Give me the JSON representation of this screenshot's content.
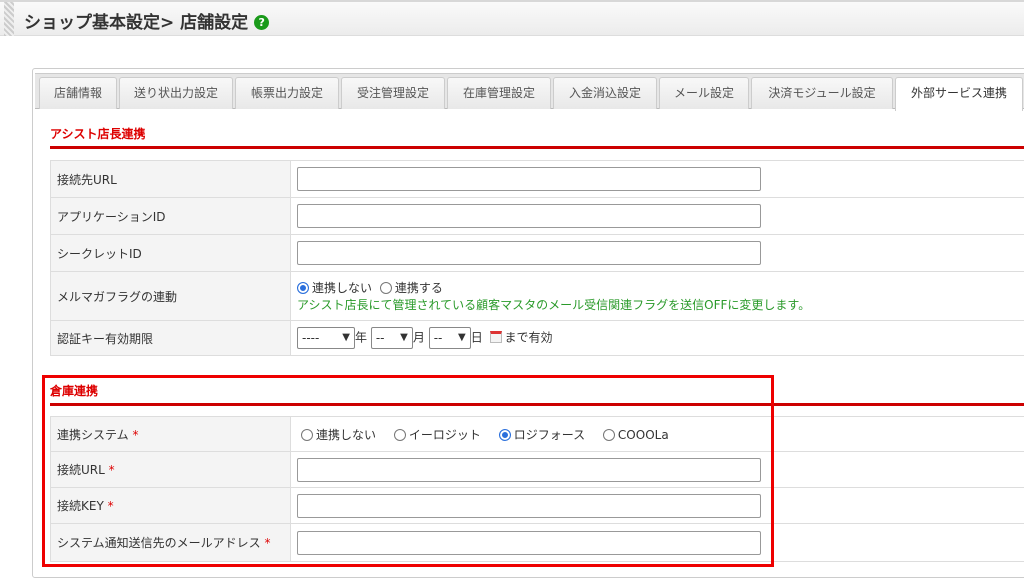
{
  "header": {
    "title": "ショップ基本設定> 店舗設定",
    "help_icon": "?"
  },
  "tabs": [
    "店舗情報",
    "送り状出力設定",
    "帳票出力設定",
    "受注管理設定",
    "在庫管理設定",
    "入金消込設定",
    "メール設定",
    "決済モジュール設定",
    "外部サービス連携"
  ],
  "active_tab": "外部サービス連携",
  "assist": {
    "title": "アシスト店長連携",
    "url_label": "接続先URL",
    "url_value": "",
    "app_id_label": "アプリケーションID",
    "app_id_value": "",
    "secret_label": "シークレットID",
    "secret_value": "",
    "mailmag_label": "メルマガフラグの連動",
    "mailmag_opt_off": "連携しない",
    "mailmag_opt_on": "連携する",
    "mailmag_selected": "連携しない",
    "mailmag_note": "アシスト店長にて管理されている顧客マスタのメール受信関連フラグを送信OFFに変更します。",
    "expiry_label": "認証キー有効期限",
    "year_value": "----",
    "year_suffix": "年",
    "month_value": "--",
    "month_suffix": "月",
    "day_value": "--",
    "day_suffix": "日",
    "expiry_suffix": "まで有効"
  },
  "warehouse": {
    "title": "倉庫連携",
    "required_mark": "*",
    "system_label": "連携システム",
    "options": [
      "連携しない",
      "イーロジット",
      "ロジフォース",
      "COOOLa"
    ],
    "selected": "ロジフォース",
    "url_label": "接続URL",
    "url_value": "",
    "key_label": "接続KEY",
    "key_value": "",
    "email_label": "システム通知送信先のメールアドレス",
    "email_value": ""
  }
}
